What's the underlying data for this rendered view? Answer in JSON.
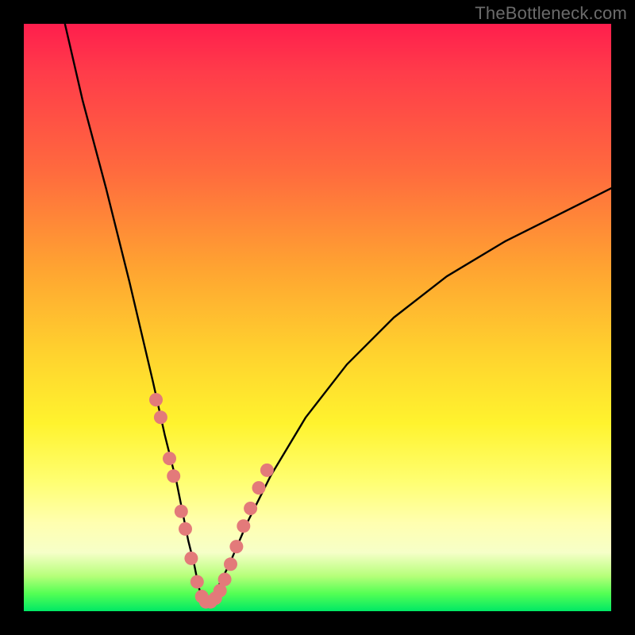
{
  "watermark": "TheBottleneck.com",
  "colors": {
    "background": "#000000",
    "curve_stroke": "#000000",
    "marker_fill": "#e37a7a",
    "gradient_stops": [
      "#ff1e4d",
      "#ff6a3e",
      "#ffd22e",
      "#ffff72",
      "#00e865"
    ]
  },
  "chart_data": {
    "type": "line",
    "title": "",
    "xlabel": "",
    "ylabel": "",
    "xlim": [
      0,
      100
    ],
    "ylim": [
      0,
      100
    ],
    "note": "Axes are unlabeled in the source image; values below are geometric estimates in percent-of-plot coordinates (0,0 = bottom-left).",
    "series": [
      {
        "name": "curve",
        "x": [
          7,
          10,
          14,
          18,
          22,
          24,
          26,
          27,
          28,
          29,
          29.8,
          30.5,
          31.2,
          32,
          33,
          35,
          38,
          42,
          48,
          55,
          63,
          72,
          82,
          92,
          100
        ],
        "y": [
          100,
          87,
          72,
          56,
          39,
          30,
          22,
          17,
          12,
          8,
          4,
          2,
          1.5,
          2,
          4,
          8,
          15,
          23,
          33,
          42,
          50,
          57,
          63,
          68,
          72
        ]
      }
    ],
    "markers": {
      "name": "highlighted-points",
      "x": [
        22.5,
        23.3,
        24.8,
        25.5,
        26.8,
        27.5,
        28.5,
        29.5,
        30.3,
        31.0,
        31.8,
        32.6,
        33.4,
        34.2,
        35.2,
        36.2,
        37.4,
        38.6,
        40.0,
        41.4
      ],
      "y": [
        36,
        33,
        26,
        23,
        17,
        14,
        9,
        5,
        2.5,
        1.6,
        1.6,
        2.2,
        3.5,
        5.4,
        8,
        11,
        14.5,
        17.5,
        21,
        24
      ]
    }
  }
}
